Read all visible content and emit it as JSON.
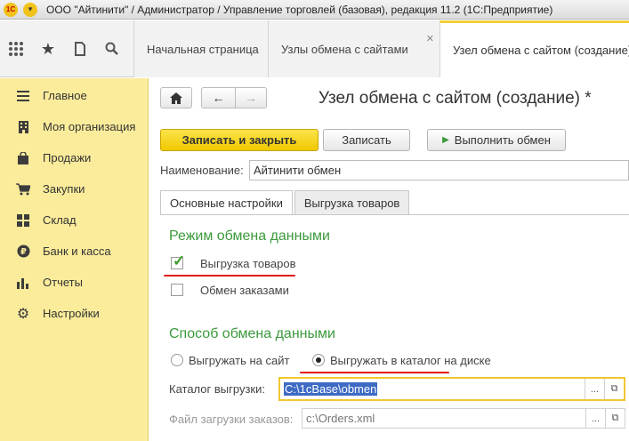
{
  "window": {
    "title": "ООО \"Айтинити\" / Администратор / Управление торговлей (базовая), редакция 11.2  (1С:Предприятие)",
    "logo_text": "1C"
  },
  "toolbar_icons": [
    "apps-grid-icon",
    "star-icon",
    "history-icon",
    "search-icon"
  ],
  "tabs": [
    {
      "label": "Начальная страница",
      "active": false
    },
    {
      "label": "Узлы обмена с сайтами",
      "active": false
    },
    {
      "label": "Узел обмена с сайтом (создание)",
      "active": true
    }
  ],
  "sidebar": {
    "items": [
      {
        "label": "Главное",
        "icon": "menu-lines-icon"
      },
      {
        "label": "Моя организация",
        "icon": "building-icon"
      },
      {
        "label": "Продажи",
        "icon": "bag-icon"
      },
      {
        "label": "Закупки",
        "icon": "cart-icon"
      },
      {
        "label": "Склад",
        "icon": "warehouse-icon"
      },
      {
        "label": "Банк и касса",
        "icon": "ruble-coin-icon"
      },
      {
        "label": "Отчеты",
        "icon": "bar-chart-icon"
      },
      {
        "label": "Настройки",
        "icon": "gear-icon"
      }
    ]
  },
  "form": {
    "title": "Узел обмена с сайтом (создание) *",
    "buttons": {
      "save_close": "Записать и закрыть",
      "save": "Записать",
      "run_exchange": "Выполнить обмен"
    },
    "name_label": "Наименование:",
    "name_value": "Айтинити обмен",
    "tabs": [
      {
        "label": "Основные настройки",
        "active": true
      },
      {
        "label": "Выгрузка товаров",
        "active": false
      }
    ],
    "mode_section": {
      "title": "Режим обмена данными",
      "export_goods": {
        "label": "Выгрузка товаров",
        "checked": true
      },
      "exchange_orders": {
        "label": "Обмен заказами",
        "checked": false
      }
    },
    "method_section": {
      "title": "Способ обмена данными",
      "option_site": {
        "label": "Выгружать на сайт",
        "selected": false
      },
      "option_disk": {
        "label": "Выгружать в каталог на диске",
        "selected": true
      }
    },
    "export_dir_label": "Каталог выгрузки:",
    "export_dir_value": "C:\\1cBase\\obmen",
    "orders_file_label": "Файл загрузки заказов:",
    "orders_file_value": "c:\\Orders.xml",
    "accent_color": "#3c9a3c",
    "highlight_color": "#e01818"
  }
}
